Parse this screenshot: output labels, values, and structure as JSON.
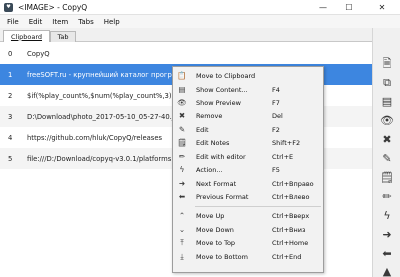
{
  "window": {
    "title": "<IMAGE> - CopyQ",
    "icon_glyph": "♥",
    "minimize_glyph": "—",
    "maximize_glyph": "☐",
    "close_glyph": "✕"
  },
  "menubar": [
    "File",
    "Edit",
    "Item",
    "Tabs",
    "Help"
  ],
  "tabs": [
    {
      "label": "Clipboard",
      "active": true
    },
    {
      "label": "Tab",
      "active": false
    }
  ],
  "items": [
    {
      "num": "0",
      "text": "CopyQ"
    },
    {
      "num": "1",
      "text": "freeSOFT.ru - крупнейший каталог программ",
      "selected": true
    },
    {
      "num": "2",
      "text": "$if(%play_count%,$num(%play_count%,3),$rgb(192,192,192)000)"
    },
    {
      "num": "3",
      "text": "D:\\Download\\photo_2017-05-10_05-27-40.jpeg"
    },
    {
      "num": "4",
      "text": "https://github.com/hluk/CopyQ/releases"
    },
    {
      "num": "5",
      "text": "file:///D:/Download/copyq-v3.0.1/platforms"
    }
  ],
  "toolbar_icons": [
    {
      "name": "new-item-icon",
      "glyph": "🗎"
    },
    {
      "name": "copy-icon",
      "glyph": "⧉"
    },
    {
      "name": "show-content-icon",
      "glyph": "▤"
    },
    {
      "name": "preview-icon",
      "glyph": "👁"
    },
    {
      "name": "remove-icon",
      "glyph": "✖"
    },
    {
      "name": "edit-icon",
      "glyph": "✎"
    },
    {
      "name": "edit-notes-icon",
      "glyph": "🗒"
    },
    {
      "name": "edit-with-editor-icon",
      "glyph": "✏"
    },
    {
      "name": "action-icon",
      "glyph": "ϟ"
    },
    {
      "name": "next-format-icon",
      "glyph": "➜"
    },
    {
      "name": "previous-format-icon",
      "glyph": "⬅"
    },
    {
      "name": "move-up-icon",
      "glyph": "▲"
    }
  ],
  "context_menu": {
    "items": [
      {
        "label": "Move to Clipboard",
        "shortcut": "",
        "icon": "clipboard-icon",
        "glyph": "📋"
      },
      {
        "label": "Show Content...",
        "shortcut": "F4",
        "icon": "show-content-icon",
        "glyph": "▤"
      },
      {
        "label": "Show Preview",
        "shortcut": "F7",
        "icon": "preview-icon",
        "glyph": "👁"
      },
      {
        "label": "Remove",
        "shortcut": "Del",
        "icon": "remove-icon",
        "glyph": "✖"
      },
      {
        "label": "Edit",
        "shortcut": "F2",
        "icon": "edit-icon",
        "glyph": "✎"
      },
      {
        "label": "Edit Notes",
        "shortcut": "Shift+F2",
        "icon": "edit-notes-icon",
        "glyph": "🗒"
      },
      {
        "label": "Edit with editor",
        "shortcut": "Ctrl+E",
        "icon": "edit-with-editor-icon",
        "glyph": "✏"
      },
      {
        "label": "Action...",
        "shortcut": "F5",
        "icon": "action-icon",
        "glyph": "ϟ"
      },
      {
        "label": "Next Format",
        "shortcut": "Ctrl+Вправо",
        "icon": "next-format-icon",
        "glyph": "➜"
      },
      {
        "label": "Previous Format",
        "shortcut": "Ctrl+Влево",
        "icon": "previous-format-icon",
        "glyph": "⬅"
      },
      {
        "label": "Move Up",
        "shortcut": "Ctrl+Вверх",
        "icon": "move-up-icon",
        "glyph": "⌃"
      },
      {
        "label": "Move Down",
        "shortcut": "Ctrl+Вниз",
        "icon": "move-down-icon",
        "glyph": "⌄"
      },
      {
        "label": "Move to Top",
        "shortcut": "Ctrl+Home",
        "icon": "move-to-top-icon",
        "glyph": "⤒"
      },
      {
        "label": "Move to Bottom",
        "shortcut": "Ctrl+End",
        "icon": "move-to-bottom-icon",
        "glyph": "⤓"
      }
    ]
  }
}
